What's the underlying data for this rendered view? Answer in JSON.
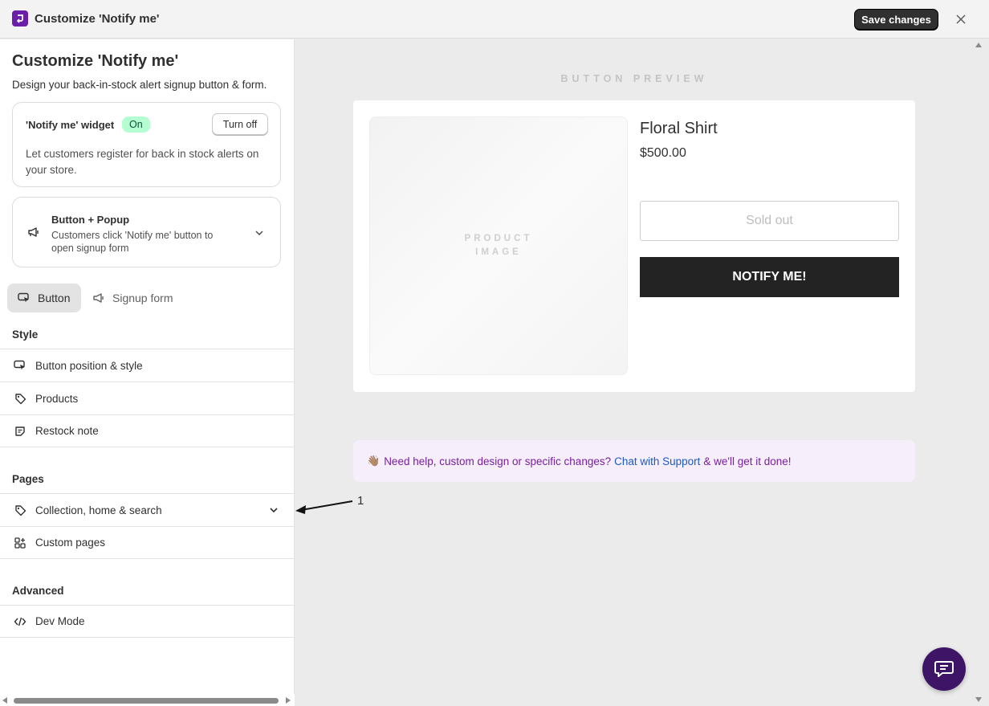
{
  "topbar": {
    "title": "Customize 'Notify me'",
    "save_label": "Save changes",
    "brand_color": "#6b1ea8"
  },
  "sidebar": {
    "title": "Customize 'Notify me'",
    "subtitle": "Design your back-in-stock alert signup button & form.",
    "widget_card": {
      "label": "'Notify me' widget",
      "status": "On",
      "toggle_label": "Turn off",
      "description": "Let customers register for back in stock alerts on your store."
    },
    "mode_card": {
      "icon": "megaphone-icon",
      "title": "Button + Popup",
      "description": "Customers click 'Notify me' button to open signup form"
    },
    "tabs": [
      {
        "label": "Button",
        "icon": "cursor-click-icon",
        "active": true
      },
      {
        "label": "Signup form",
        "icon": "megaphone-icon",
        "active": false
      }
    ],
    "sections": {
      "style": {
        "heading": "Style",
        "items": [
          {
            "label": "Button position & style",
            "icon": "cursor-click-icon"
          },
          {
            "label": "Products",
            "icon": "tag-icon"
          },
          {
            "label": "Restock note",
            "icon": "note-icon"
          }
        ]
      },
      "pages": {
        "heading": "Pages",
        "items": [
          {
            "label": "Collection, home & search",
            "icon": "tag-icon",
            "expandable": true
          },
          {
            "label": "Custom pages",
            "icon": "apps-icon"
          }
        ]
      },
      "advanced": {
        "heading": "Advanced",
        "items": [
          {
            "label": "Dev Mode",
            "icon": "code-icon"
          }
        ]
      }
    }
  },
  "preview": {
    "label": "BUTTON PREVIEW",
    "product_image_text": "PRODUCT IMAGE",
    "product_name": "Floral Shirt",
    "price": "$500.00",
    "sold_out_label": "Sold out",
    "notify_label": "NOTIFY ME!"
  },
  "help": {
    "emoji": "👋🏽",
    "text_before": "Need help, custom design or specific changes?",
    "link_text": "Chat with Support",
    "text_after": "& we'll get it done!"
  },
  "annotation": {
    "number": "1"
  }
}
